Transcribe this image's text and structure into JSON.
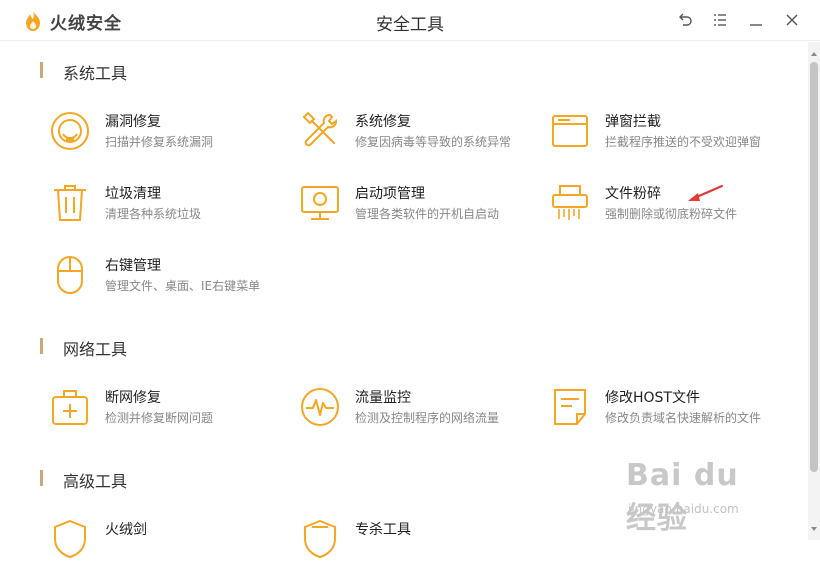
{
  "app": {
    "brand": "火绒安全",
    "window_title": "安全工具"
  },
  "titlebar": {
    "controls": [
      "back-icon",
      "menu-icon",
      "minimize-icon",
      "close-icon"
    ]
  },
  "sections": [
    {
      "title": "系统工具",
      "tools": [
        {
          "name": "漏洞修复",
          "desc": "扫描并修复系统漏洞",
          "icon": "vulnerability-repair-icon"
        },
        {
          "name": "系统修复",
          "desc": "修复因病毒等导致的系统异常",
          "icon": "system-repair-icon"
        },
        {
          "name": "弹窗拦截",
          "desc": "拦截程序推送的不受欢迎弹窗",
          "icon": "popup-block-icon"
        },
        {
          "name": "垃圾清理",
          "desc": "清理各种系统垃圾",
          "icon": "trash-clean-icon"
        },
        {
          "name": "启动项管理",
          "desc": "管理各类软件的开机自启动",
          "icon": "startup-manager-icon"
        },
        {
          "name": "文件粉碎",
          "desc": "强制删除或彻底粉碎文件",
          "icon": "file-shredder-icon"
        },
        {
          "name": "右键管理",
          "desc": "管理文件、桌面、IE右键菜单",
          "icon": "mouse-icon"
        }
      ]
    },
    {
      "title": "网络工具",
      "tools": [
        {
          "name": "断网修复",
          "desc": "检测并修复断网问题",
          "icon": "network-repair-icon"
        },
        {
          "name": "流量监控",
          "desc": "检测及控制程序的网络流量",
          "icon": "traffic-monitor-icon"
        },
        {
          "name": "修改HOST文件",
          "desc": "修改负责域名快速解析的文件",
          "icon": "host-file-icon"
        }
      ]
    },
    {
      "title": "高级工具",
      "tools": [
        {
          "name": "火绒剑",
          "desc": "",
          "icon": "sword-shield-icon"
        },
        {
          "name": "专杀工具",
          "desc": "",
          "icon": "antivirus-shield-icon"
        }
      ]
    }
  ],
  "watermark": {
    "logo": "Bai du 经验",
    "url": "jingyan.baidu.com"
  },
  "colors": {
    "accent": "#f5a623",
    "section_bar": "#c9a97a",
    "annotation_arrow": "#e53935"
  }
}
